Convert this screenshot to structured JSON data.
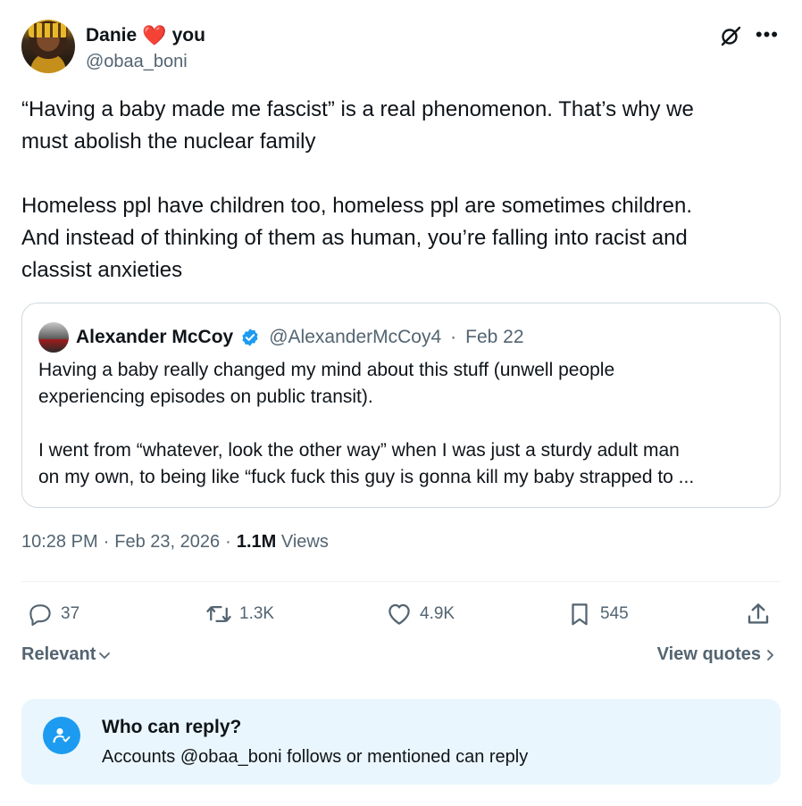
{
  "author": {
    "display_name": "Danie",
    "name_suffix": "you",
    "heart_icon": "heart-emoji",
    "handle": "@obaa_boni"
  },
  "tweet": {
    "paragraphs": [
      "“Having a baby made me fascist” is a real phenomenon. That’s why we",
      "must abolish the nuclear family",
      "",
      "Homeless ppl have children too, homeless ppl are sometimes children.",
      "And instead of thinking of them as human, you’re falling into racist and",
      "classist anxieties"
    ]
  },
  "quote": {
    "name": "Alexander McCoy",
    "handle": "@AlexanderMcCoy4",
    "separator": "·",
    "date": "Feb 22",
    "lines": [
      "Having a baby really changed my mind about this stuff (unwell people",
      "experiencing episodes on public transit).",
      "",
      "I went from “whatever, look the other way” when I was just a sturdy adult man",
      "on my own, to being like “fuck fuck this guy is gonna kill my baby strapped to ..."
    ]
  },
  "meta": {
    "time": "10:28 PM",
    "sep1": "·",
    "date": "Feb 23, 2026",
    "sep2": "·",
    "views_count": "1.1M",
    "views_label": "Views"
  },
  "actions": {
    "replies": "37",
    "reposts": "1.3K",
    "likes": "4.9K",
    "bookmarks": "545"
  },
  "sort": {
    "relevant_label": "Relevant",
    "view_quotes_label": "View quotes"
  },
  "reply_settings": {
    "title": "Who can reply?",
    "description": "Accounts @obaa_boni follows or mentioned can reply"
  },
  "colors": {
    "accent": "#1d9bf0",
    "secondary_text": "#536471",
    "heart": "#e0245e",
    "reply_box_bg": "#eaf6fd"
  }
}
